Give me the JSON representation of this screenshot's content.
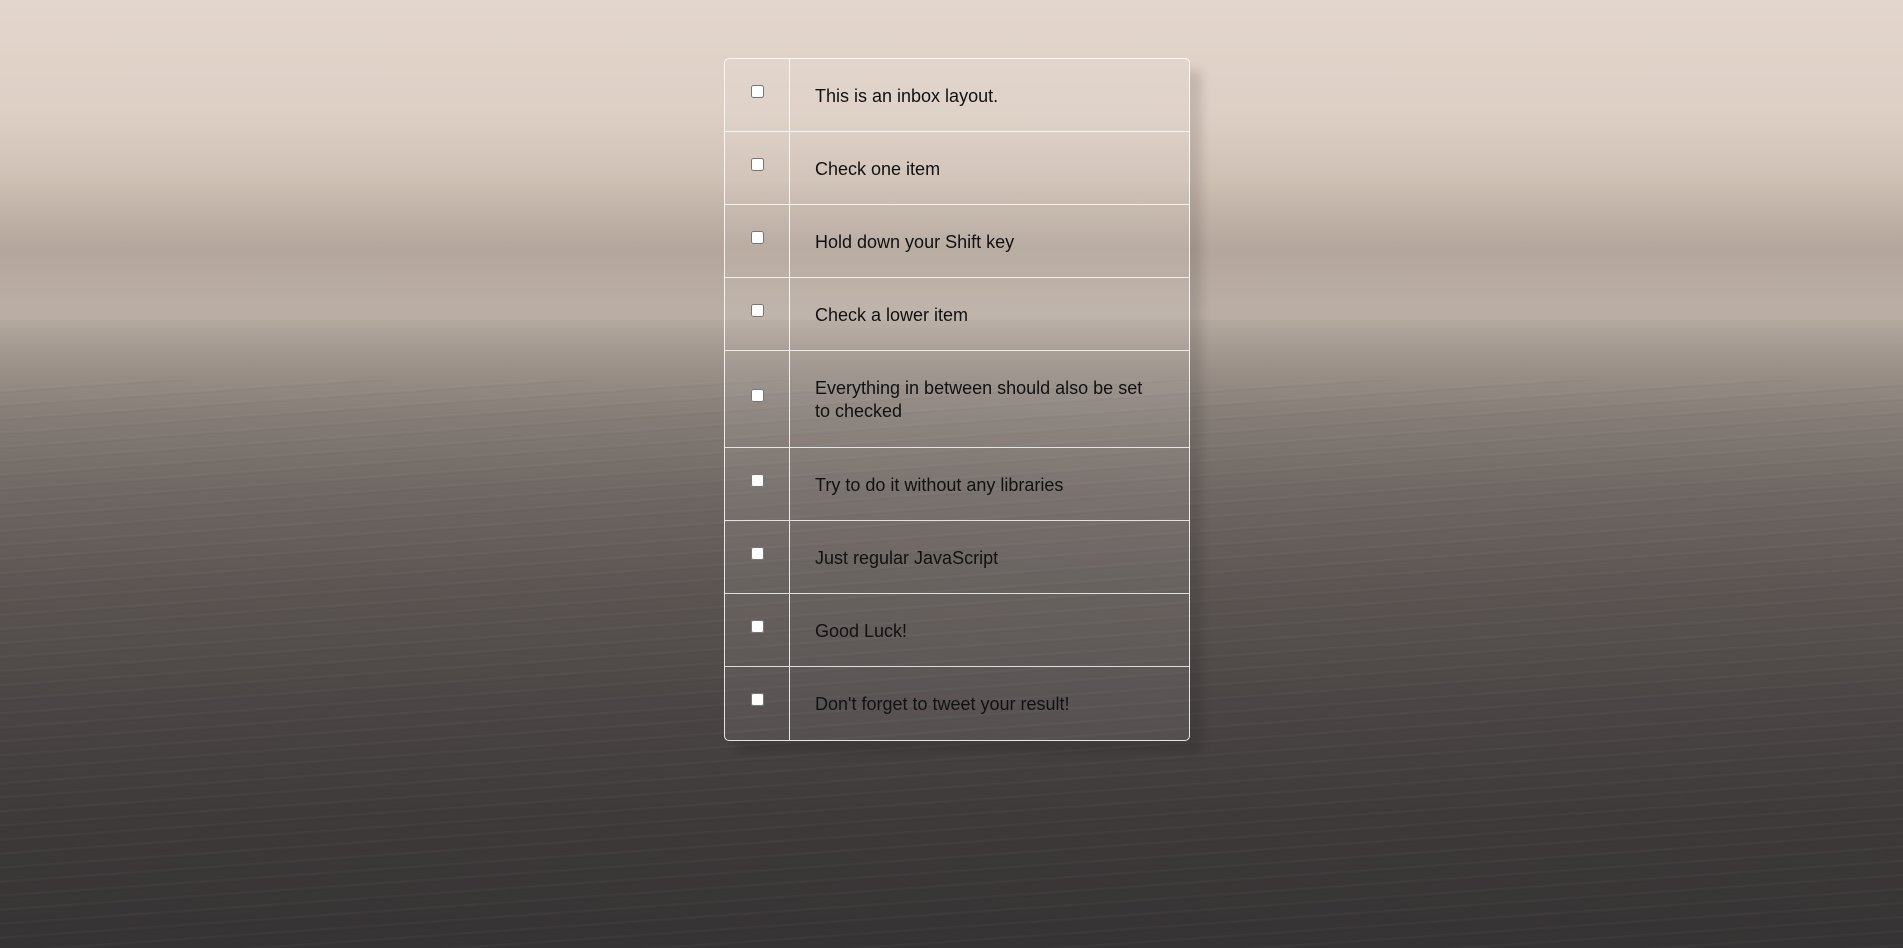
{
  "inbox": {
    "items": [
      {
        "label": "This is an inbox layout.",
        "checked": false
      },
      {
        "label": "Check one item",
        "checked": false
      },
      {
        "label": "Hold down your Shift key",
        "checked": false
      },
      {
        "label": "Check a lower item",
        "checked": false
      },
      {
        "label": "Everything in between should also be set to checked",
        "checked": false
      },
      {
        "label": "Try to do it without any libraries",
        "checked": false
      },
      {
        "label": "Just regular JavaScript",
        "checked": false
      },
      {
        "label": "Good Luck!",
        "checked": false
      },
      {
        "label": "Don't forget to tweet your result!",
        "checked": false
      }
    ]
  }
}
